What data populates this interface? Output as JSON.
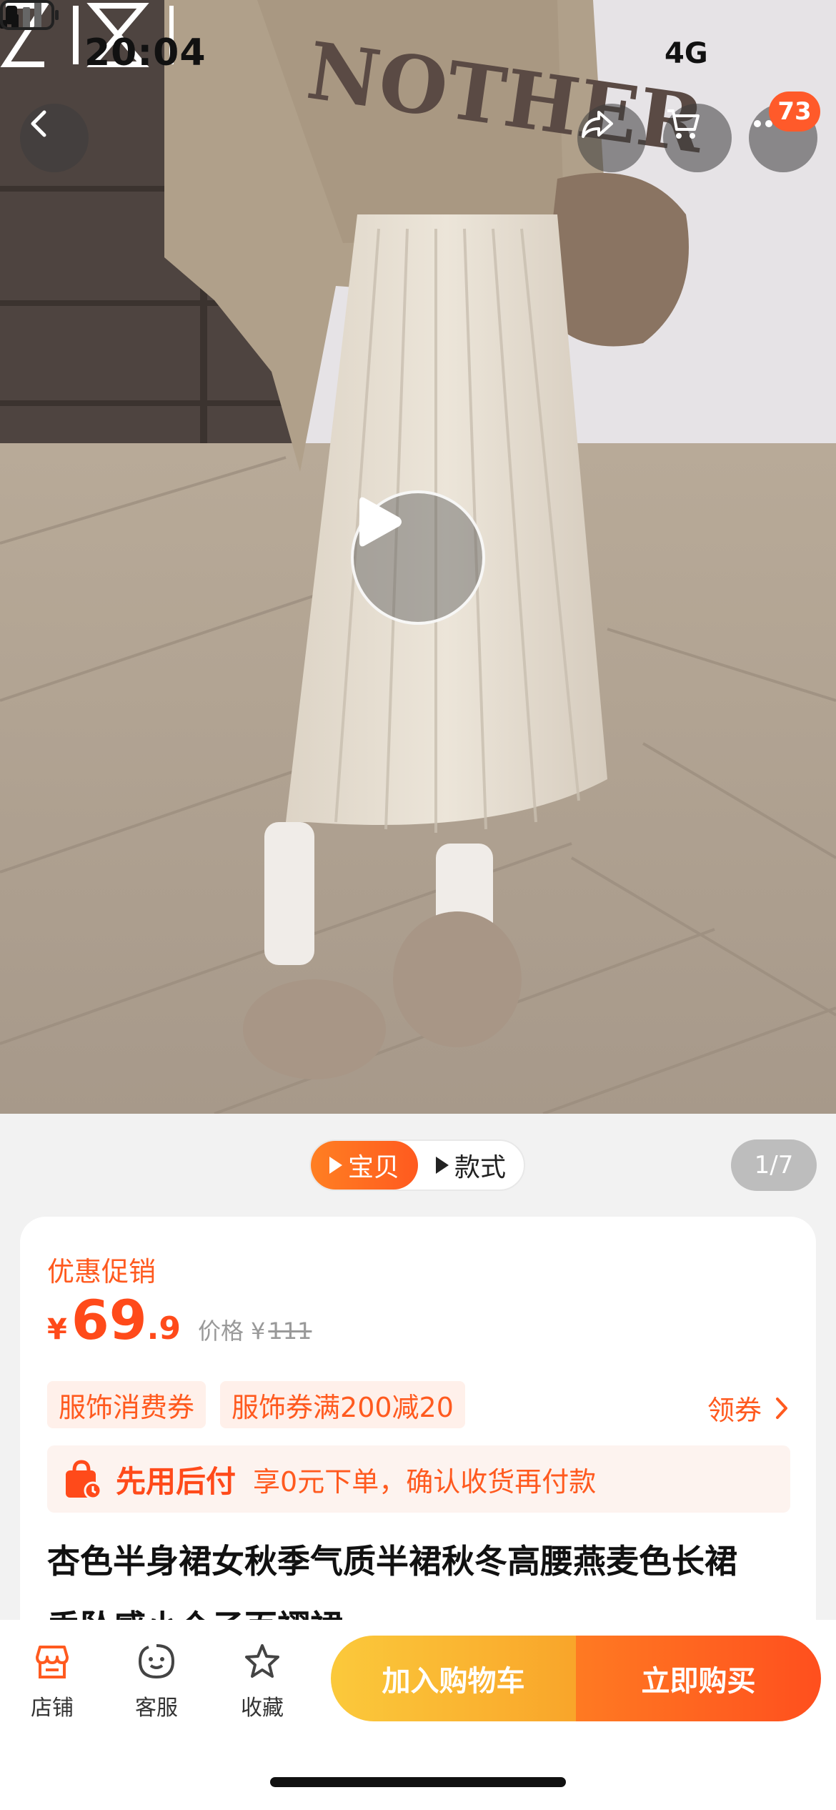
{
  "status_bar": {
    "time": "20:04",
    "network": "4G"
  },
  "nav": {
    "cart_badge": "73"
  },
  "media": {
    "tabs": [
      {
        "label": "宝贝",
        "active": true
      },
      {
        "label": "款式",
        "active": false
      }
    ],
    "counter": "1/7"
  },
  "product": {
    "promo_label": "优惠促销",
    "price": {
      "symbol": "¥",
      "integer": "69",
      "decimal": ".9"
    },
    "original_price": {
      "label": "价格",
      "symbol": "¥",
      "value": "111"
    },
    "coupons": [
      "服饰消费券",
      "服饰券满200减20"
    ],
    "get_coupon": "领券",
    "paylater": {
      "title": "先用后付",
      "desc": "享0元下单，确认收货再付款"
    },
    "title_line1": "杏色半身裙女秋季气质半裙秋冬高腰燕麦色长裙",
    "title_line2": "垂坠感小个子百褶裙"
  },
  "bottom_bar": {
    "shop": "店铺",
    "service": "客服",
    "favorite": "收藏",
    "add_to_cart": "加入购物车",
    "buy_now": "立即购买"
  },
  "icons": {
    "back": "chevron-left-icon",
    "share": "share-icon",
    "cart": "cart-icon",
    "more": "more-icon",
    "play": "play-icon",
    "shop": "shop-icon",
    "service": "service-icon",
    "favorite": "star-icon",
    "paylater": "shopping-bag-icon"
  },
  "colors": {
    "accent": "#ff5a1f",
    "price": "#ff4a1a",
    "cart_button": "#f9b42f",
    "buy_button": "#ff5a1f"
  }
}
